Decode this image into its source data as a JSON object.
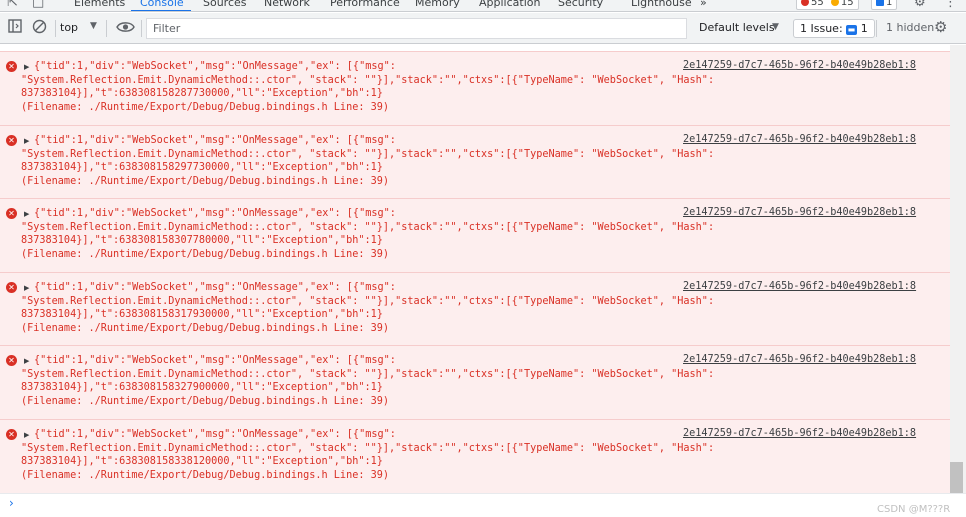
{
  "tabbar": {
    "tabs": [
      {
        "label": "Elements"
      },
      {
        "label": "Console"
      },
      {
        "label": "Sources"
      },
      {
        "label": "Network"
      },
      {
        "label": "Performance"
      },
      {
        "label": "Memory"
      },
      {
        "label": "Application"
      },
      {
        "label": "Security"
      },
      {
        "label": "Lighthouse"
      }
    ],
    "more": "»",
    "error_count": "55",
    "warning_count": "15",
    "info_count": "1",
    "colors": {
      "error": "#d93025",
      "warning": "#f9ab00",
      "info": "#1a73e8"
    }
  },
  "toolbar": {
    "context": "top",
    "filter_placeholder": "Filter",
    "levels": "Default levels",
    "issues": "1 Issue:",
    "issues_count": "1",
    "hidden": "1 hidden"
  },
  "entries": [
    {
      "line1": "{\"tid\":1,\"div\":\"WebSocket\",\"msg\":\"OnMessage\",\"ex\": [{\"msg\":",
      "line2": "\"System.Reflection.Emit.DynamicMethod::.ctor\", \"stack\": \"\"}],\"stack\":\"\",\"ctxs\":[{\"TypeName\": \"WebSocket\", \"Hash\":",
      "line3": "837383104}],\"t\":638308158287730000,\"ll\":\"Exception\",\"bh\":1}",
      "line4": "(Filename: ./Runtime/Export/Debug/Debug.bindings.h Line: 39)",
      "source": "2e147259-d7c7-465b-96f2-b40e49b28eb1:8"
    },
    {
      "line1": "{\"tid\":1,\"div\":\"WebSocket\",\"msg\":\"OnMessage\",\"ex\": [{\"msg\":",
      "line2": "\"System.Reflection.Emit.DynamicMethod::.ctor\", \"stack\": \"\"}],\"stack\":\"\",\"ctxs\":[{\"TypeName\": \"WebSocket\", \"Hash\":",
      "line3": "837383104}],\"t\":638308158297730000,\"ll\":\"Exception\",\"bh\":1}",
      "line4": "(Filename: ./Runtime/Export/Debug/Debug.bindings.h Line: 39)",
      "source": "2e147259-d7c7-465b-96f2-b40e49b28eb1:8"
    },
    {
      "line1": "{\"tid\":1,\"div\":\"WebSocket\",\"msg\":\"OnMessage\",\"ex\": [{\"msg\":",
      "line2": "\"System.Reflection.Emit.DynamicMethod::.ctor\", \"stack\": \"\"}],\"stack\":\"\",\"ctxs\":[{\"TypeName\": \"WebSocket\", \"Hash\":",
      "line3": "837383104}],\"t\":638308158307780000,\"ll\":\"Exception\",\"bh\":1}",
      "line4": "(Filename: ./Runtime/Export/Debug/Debug.bindings.h Line: 39)",
      "source": "2e147259-d7c7-465b-96f2-b40e49b28eb1:8"
    },
    {
      "line1": "{\"tid\":1,\"div\":\"WebSocket\",\"msg\":\"OnMessage\",\"ex\": [{\"msg\":",
      "line2": "\"System.Reflection.Emit.DynamicMethod::.ctor\", \"stack\": \"\"}],\"stack\":\"\",\"ctxs\":[{\"TypeName\": \"WebSocket\", \"Hash\":",
      "line3": "837383104}],\"t\":638308158317930000,\"ll\":\"Exception\",\"bh\":1}",
      "line4": "(Filename: ./Runtime/Export/Debug/Debug.bindings.h Line: 39)",
      "source": "2e147259-d7c7-465b-96f2-b40e49b28eb1:8"
    },
    {
      "line1": "{\"tid\":1,\"div\":\"WebSocket\",\"msg\":\"OnMessage\",\"ex\": [{\"msg\":",
      "line2": "\"System.Reflection.Emit.DynamicMethod::.ctor\", \"stack\": \"\"}],\"stack\":\"\",\"ctxs\":[{\"TypeName\": \"WebSocket\", \"Hash\":",
      "line3": "837383104}],\"t\":638308158327900000,\"ll\":\"Exception\",\"bh\":1}",
      "line4": "(Filename: ./Runtime/Export/Debug/Debug.bindings.h Line: 39)",
      "source": "2e147259-d7c7-465b-96f2-b40e49b28eb1:8"
    },
    {
      "line1": "{\"tid\":1,\"div\":\"WebSocket\",\"msg\":\"OnMessage\",\"ex\": [{\"msg\":",
      "line2": "\"System.Reflection.Emit.DynamicMethod::.ctor\", \"stack\": \"\"}],\"stack\":\"\",\"ctxs\":[{\"TypeName\": \"WebSocket\", \"Hash\":",
      "line3": "837383104}],\"t\":638308158338120000,\"ll\":\"Exception\",\"bh\":1}",
      "line4": "(Filename: ./Runtime/Export/Debug/Debug.bindings.h Line: 39)",
      "source": "2e147259-d7c7-465b-96f2-b40e49b28eb1:8"
    }
  ],
  "prompt": {
    "caret": "›"
  },
  "watermark": "CSDN @M???R"
}
